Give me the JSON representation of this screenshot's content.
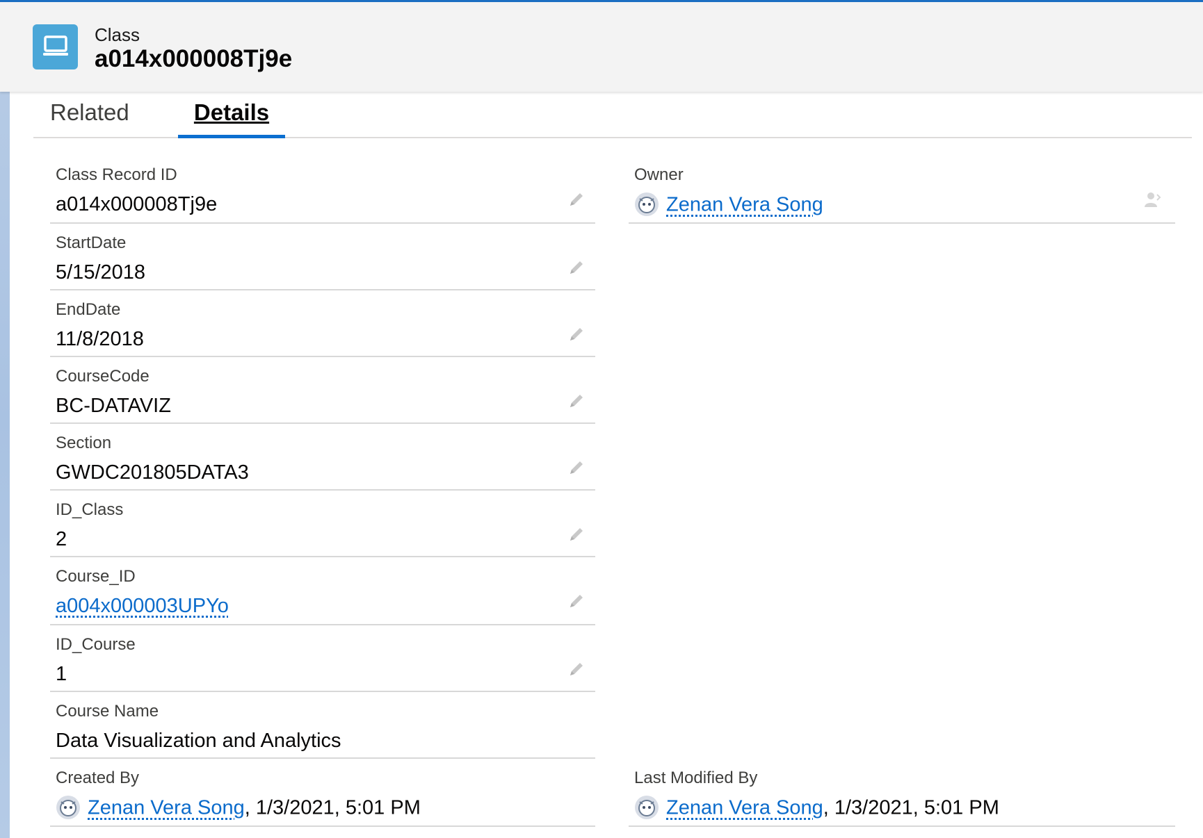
{
  "header": {
    "object_type": "Class",
    "record_title": "a014x000008Tj9e",
    "icon": "computer-icon"
  },
  "tabs": [
    {
      "label": "Related",
      "active": false
    },
    {
      "label": "Details",
      "active": true
    }
  ],
  "fields_left": [
    {
      "label": "Class Record ID",
      "value": "a014x000008Tj9e",
      "editable": true
    },
    {
      "label": "StartDate",
      "value": "5/15/2018",
      "editable": true
    },
    {
      "label": "EndDate",
      "value": "11/8/2018",
      "editable": true
    },
    {
      "label": "CourseCode",
      "value": "BC-DATAVIZ",
      "editable": true
    },
    {
      "label": "Section",
      "value": "GWDC201805DATA3",
      "editable": true
    },
    {
      "label": "ID_Class",
      "value": "2",
      "editable": true
    },
    {
      "label": "Course_ID",
      "value": "a004x000003UPYo",
      "editable": true,
      "link": true
    },
    {
      "label": "ID_Course",
      "value": "1",
      "editable": true
    },
    {
      "label": "Course Name",
      "value": "Data Visualization and Analytics",
      "editable": false
    }
  ],
  "owner": {
    "label": "Owner",
    "name": "Zenan Vera Song"
  },
  "created_by": {
    "label": "Created By",
    "name": "Zenan Vera Song",
    "timestamp": ", 1/3/2021, 5:01 PM"
  },
  "last_modified_by": {
    "label": "Last Modified By",
    "name": "Zenan Vera Song",
    "timestamp": ", 1/3/2021, 5:01 PM"
  },
  "colors": {
    "accent": "#0b6fd0",
    "link": "#0b6bcb",
    "icon_bg": "#4ba7d8"
  }
}
